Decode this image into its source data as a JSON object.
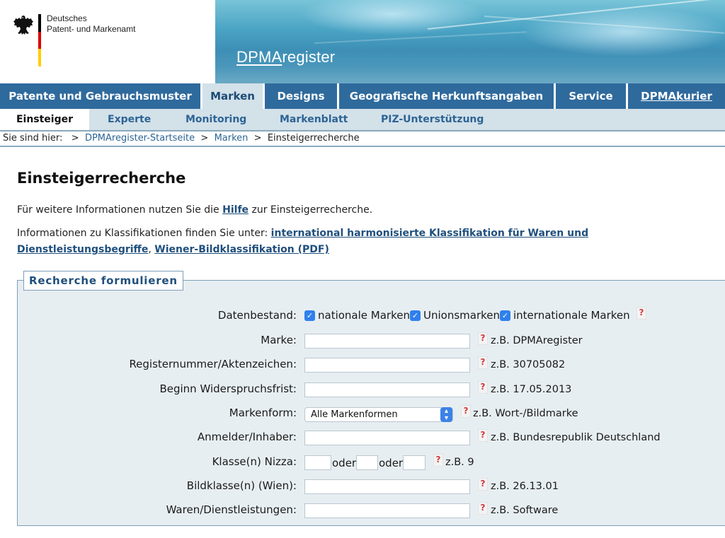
{
  "header": {
    "logo_line1": "Deutsches",
    "logo_line2": "Patent- und Markenamt",
    "banner_title_prefix": "DPMA",
    "banner_title_suffix": "register"
  },
  "mainnav": [
    {
      "label": "Patente und Gebrauchsmuster"
    },
    {
      "label": "Marken"
    },
    {
      "label": "Designs"
    },
    {
      "label": "Geografische Herkunftsangaben"
    },
    {
      "label": "Service"
    },
    {
      "label": "DPMAkurier"
    }
  ],
  "subnav": [
    {
      "label": "Einsteiger"
    },
    {
      "label": "Experte"
    },
    {
      "label": "Monitoring"
    },
    {
      "label": "Markenblatt"
    },
    {
      "label": "PIZ-Unterstützung"
    }
  ],
  "breadcrumb": {
    "prefix": "Sie sind hier:",
    "sep": ">",
    "items": [
      "DPMAregister-Startseite",
      "Marken",
      "Einsteigerrecherche"
    ]
  },
  "page": {
    "title": "Einsteigerrecherche",
    "info_before": "Für weitere Informationen nutzen Sie die ",
    "info_link": "Hilfe",
    "info_after": " zur Einsteigerrecherche.",
    "class_before": "Informationen zu Klassifikationen finden Sie unter: ",
    "class_link1": "international harmonisierte Klassifikation für Waren und Dienstleistungsbegriffe",
    "class_sep": ", ",
    "class_link2": "Wiener-Bildklassifikation (PDF)"
  },
  "form": {
    "legend": "Recherche formulieren",
    "help_glyph": "?",
    "checkmark": "✓",
    "datenbestand": {
      "label": "Datenbestand:",
      "options": [
        "nationale Marken",
        "Unionsmarken",
        "internationale Marken"
      ],
      "checked": [
        true,
        true,
        true
      ]
    },
    "marke": {
      "label": "Marke:",
      "value": "",
      "hint": "z.B. DPMAregister"
    },
    "registernummer": {
      "label": "Registernummer/Aktenzeichen:",
      "value": "",
      "hint": "z.B. 30705082"
    },
    "widerspruch": {
      "label": "Beginn Widerspruchsfrist:",
      "value": "",
      "hint": "z.B. 17.05.2013"
    },
    "markenform": {
      "label": "Markenform:",
      "selected": "Alle Markenformen",
      "hint": "z.B. Wort-/Bildmarke"
    },
    "anmelder": {
      "label": "Anmelder/Inhaber:",
      "value": "",
      "hint": "z.B. Bundesrepublik Deutschland"
    },
    "nizza": {
      "label": "Klasse(n) Nizza:",
      "oder": "oder",
      "hint": "z.B. 9"
    },
    "wien": {
      "label": "Bildklasse(n) (Wien):",
      "value": "",
      "hint": "z.B. 26.13.01"
    },
    "waren": {
      "label": "Waren/Dienstleistungen:",
      "value": "",
      "hint": "z.B. Software"
    }
  },
  "colors": {
    "nav_blue": "#2f6a9d",
    "nav_active_bg": "#d3e1e9",
    "link_blue": "#1f4f7c",
    "checkbox_blue": "#2f80ed",
    "help_red": "#d43a3a"
  }
}
